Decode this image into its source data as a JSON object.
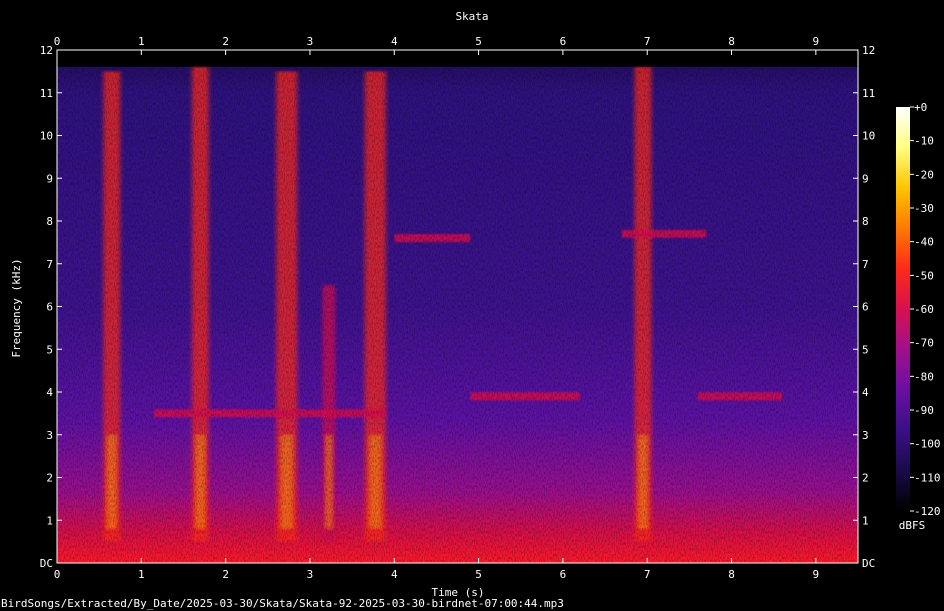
{
  "chart_data": {
    "type": "heatmap",
    "title": "Skata",
    "xlabel": "Time (s)",
    "ylabel": "Frequency (kHz)",
    "xlim": [
      0,
      9.5
    ],
    "ylim": [
      0,
      12
    ],
    "x_ticks": [
      "0",
      "1",
      "2",
      "3",
      "4",
      "5",
      "6",
      "7",
      "8",
      "9"
    ],
    "y_ticks": [
      "DC",
      "1",
      "2",
      "3",
      "4",
      "5",
      "6",
      "7",
      "8",
      "9",
      "10",
      "11",
      "12"
    ],
    "colorbar": {
      "label": "dBFS",
      "ticks": [
        "+0",
        "-10",
        "-20",
        "-30",
        "-40",
        "-50",
        "-60",
        "-70",
        "-80",
        "-90",
        "-100",
        "-110",
        "-120"
      ],
      "range": [
        -120,
        0
      ]
    },
    "colormap": [
      "#000000",
      "#1a0a4a",
      "#3a0f86",
      "#6a0fa0",
      "#a0108a",
      "#d81050",
      "#ff2a1a",
      "#ff7a00",
      "#ffc400",
      "#ffff80",
      "#ffffff"
    ],
    "calls": [
      {
        "start": 0.55,
        "end": 0.75,
        "f_low": 0.5,
        "f_high": 11.5,
        "level": -45
      },
      {
        "start": 1.6,
        "end": 1.8,
        "f_low": 0.5,
        "f_high": 11.6,
        "level": -45
      },
      {
        "start": 2.6,
        "end": 2.85,
        "f_low": 0.5,
        "f_high": 11.5,
        "level": -45
      },
      {
        "start": 3.15,
        "end": 3.3,
        "f_low": 0.5,
        "f_high": 6.5,
        "level": -55
      },
      {
        "start": 3.65,
        "end": 3.9,
        "f_low": 0.5,
        "f_high": 11.5,
        "level": -45
      },
      {
        "start": 6.85,
        "end": 7.05,
        "f_low": 0.5,
        "f_high": 11.6,
        "level": -45
      }
    ],
    "tonal_bands": [
      {
        "start": 1.15,
        "end": 3.9,
        "f_khz": 3.5,
        "level": -60
      },
      {
        "start": 4.0,
        "end": 4.9,
        "f_khz": 7.6,
        "level": -55
      },
      {
        "start": 4.9,
        "end": 6.2,
        "f_khz": 3.9,
        "level": -55
      },
      {
        "start": 6.7,
        "end": 7.7,
        "f_khz": 7.7,
        "level": -55
      },
      {
        "start": 7.6,
        "end": 8.6,
        "f_khz": 3.9,
        "level": -55
      }
    ]
  },
  "footer": {
    "filepath": "BirdSongs/Extracted/By_Date/2025-03-30/Skata/Skata-92-2025-03-30-birdnet-07:00:44.mp3"
  }
}
